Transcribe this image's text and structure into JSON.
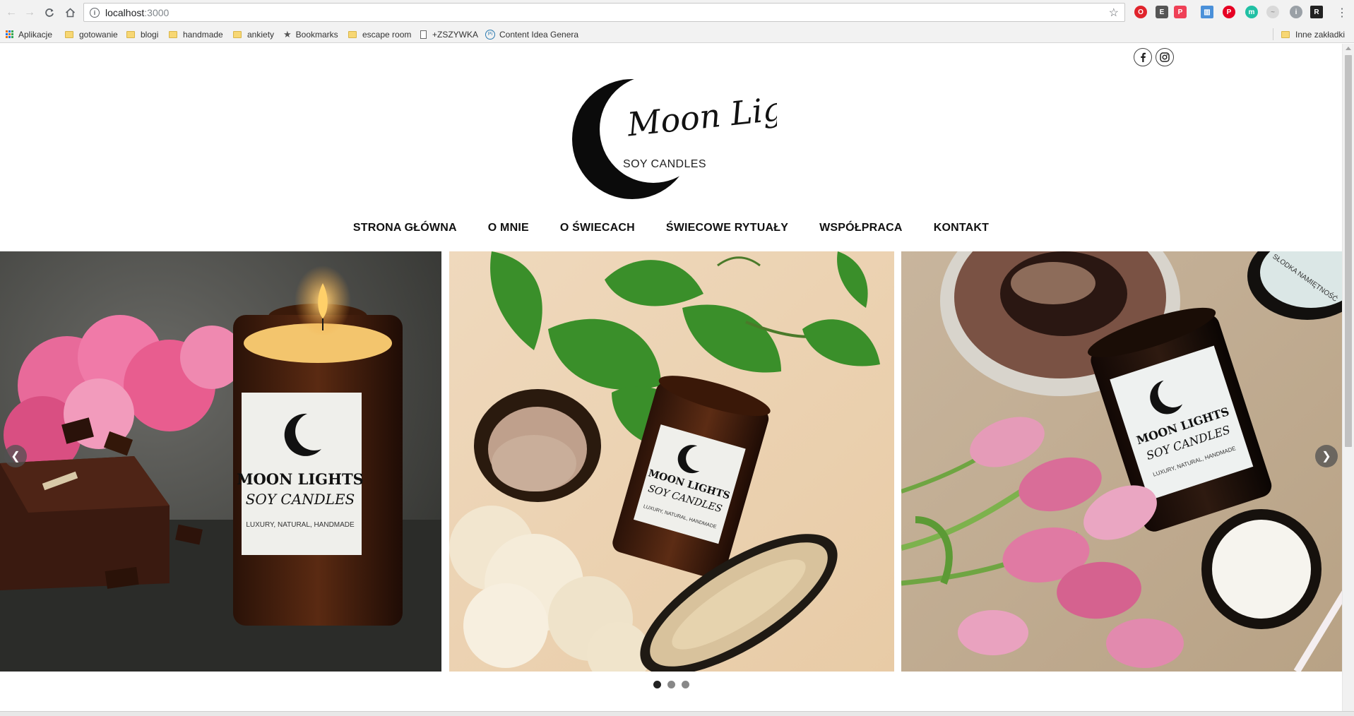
{
  "browser": {
    "url_host": "localhost",
    "url_port": ":3000"
  },
  "bookmarks": [
    {
      "label": "Aplikacje",
      "kind": "apps"
    },
    {
      "label": "gotowanie",
      "kind": "folder"
    },
    {
      "label": "blogi",
      "kind": "folder"
    },
    {
      "label": "handmade",
      "kind": "folder"
    },
    {
      "label": "ankiety",
      "kind": "folder"
    },
    {
      "label": "Bookmarks",
      "kind": "star"
    },
    {
      "label": "escape room",
      "kind": "folder"
    },
    {
      "label": "+ZSZYWKA",
      "kind": "page"
    },
    {
      "label": "Content Idea Generat",
      "kind": "site"
    },
    {
      "label": "Inne zakładki",
      "kind": "folder"
    }
  ],
  "logo": {
    "script": "Moon Lights",
    "sub": "SOY CANDLES"
  },
  "nav": [
    "STRONA GŁÓWNA",
    "O MNIE",
    "O ŚWIECACH",
    "ŚWIECOWE RYTUAŁY",
    "WSPÓŁPRACA",
    "KONTAKT"
  ],
  "slides": [
    {
      "title": "MOON LIGHTS",
      "sub": "SOY CANDLES",
      "tag": "LUXURY, NATURAL, HANDMADE"
    },
    {
      "title": "MOON LIGHTS",
      "sub": "SOY CANDLES",
      "tag": "LUXURY, NATURAL, HANDMADE"
    },
    {
      "title": "MOON LIGHTS",
      "sub": "SOY CANDLES",
      "tag": "LUXURY, NATURAL, HANDMADE",
      "lid": "SŁODKA NAMIĘTNOŚĆ"
    }
  ],
  "slider": {
    "total": 3,
    "current": 1
  },
  "colors": {
    "accent": "#111111",
    "chrome": "#f2f2f2"
  }
}
